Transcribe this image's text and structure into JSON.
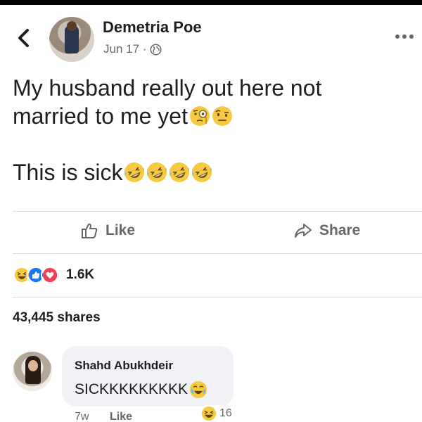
{
  "post": {
    "author": "Demetria Poe",
    "date": "Jun 17 ·",
    "privacy_icon": "globe-icon",
    "text_line1": "My husband really out here not",
    "text_line2": "married to me yet",
    "text_line2_emojis": [
      "monocle-face-emoji",
      "raised-eyebrow-emoji"
    ],
    "text_line3": "This is sick",
    "text_line3_emojis": [
      "rofl-emoji",
      "rofl-emoji",
      "rofl-emoji",
      "rofl-emoji"
    ]
  },
  "actions": {
    "like_label": "Like",
    "share_label": "Share"
  },
  "reactions": {
    "icons": [
      "haha-react",
      "like-react",
      "love-react"
    ],
    "count": "1.6K"
  },
  "shares": {
    "text": "43,445 shares"
  },
  "comment": {
    "author": "Shahd Abukhdeir",
    "text": "SICKKKKKKKKK",
    "text_emoji": "crying-emoji",
    "reaction_icon": "haha-react",
    "reaction_count": "16",
    "time": "7w",
    "like_label": "Like"
  },
  "colors": {
    "text": "#1c1e21",
    "secondary": "#65676b",
    "bubble": "#f0f2f5",
    "like_blue": "#1877f2",
    "love_red": "#f33e58",
    "emoji_yellow": "#f7c940"
  }
}
